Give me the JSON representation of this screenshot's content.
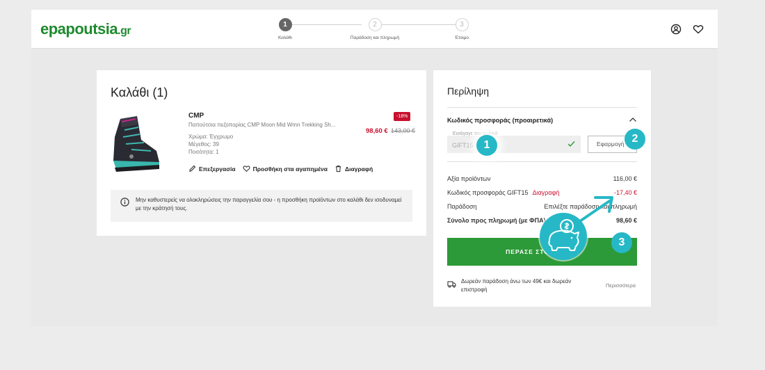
{
  "header": {
    "logo": "epapoutsia",
    "logo_suffix": ".gr",
    "steps": [
      {
        "num": "1",
        "label": "Καλάθι"
      },
      {
        "num": "2",
        "label": "Παράδοση και πληρωμή"
      },
      {
        "num": "3",
        "label": "Έτοιμο"
      }
    ],
    "icons": [
      "account-icon",
      "heart-icon"
    ]
  },
  "cart": {
    "title": "Καλάθι (1)",
    "product": {
      "brand": "CMP",
      "description": "Παπούτσια πεζοπορίας CMP Moon Mid Wmn Trekking Sh...",
      "color": "Χρώμα: Έγχρωμο",
      "size": "Μέγεθος: 39",
      "qty": "Ποσότητα: 1",
      "discount": "-18%",
      "price_new": "98,60 €",
      "price_old": "143,00 €"
    },
    "actions": {
      "edit": "Επεξεργασία",
      "wishlist": "Προσθήκη στα αγαπημένα",
      "delete": "Διαγραφή"
    },
    "notice": "Μην καθυστερείς να ολοκληρώσεις την παραγγελία σου - η προσθήκη προϊόντων στο καλάθι δεν ισοδυναμεί με την κράτησή τους."
  },
  "summary": {
    "title": "Περίληψη",
    "promo_title": "Κωδικός προσφοράς (προαιρετικά)",
    "promo_label": "Εισάγαγε τον κωδικό",
    "promo_value": "GIFT15",
    "apply": "Εφαρμογή",
    "rows": {
      "products_label": "Αξία προϊόντων",
      "products_value": "116,00 €",
      "code_label": "Κωδικός προσφοράς GIFT15",
      "code_delete": "Διαγραφή",
      "code_value": "-17,40 €",
      "delivery_label": "Παράδοση",
      "delivery_value": "Επιλέξτε παράδοση και πληρωμή",
      "total_label": "Σύνολο προς πληρωμή (με ΦΠΑ)",
      "total_value": "98,60 €"
    },
    "cta": "ΠΕΡΑΣΕ ΣΤΟ ΤΑΜΕΙΟ",
    "shipping_note": "Δωρεάν παράδοση άνω των 49€ και δωρεάν επιστροφή",
    "more": "Περισσότερα"
  },
  "annotations": [
    "1",
    "2",
    "3"
  ],
  "colors": {
    "brand_green": "#2c9a38",
    "sale_red": "#c8102e",
    "annotation_teal": "#26b8c6"
  }
}
